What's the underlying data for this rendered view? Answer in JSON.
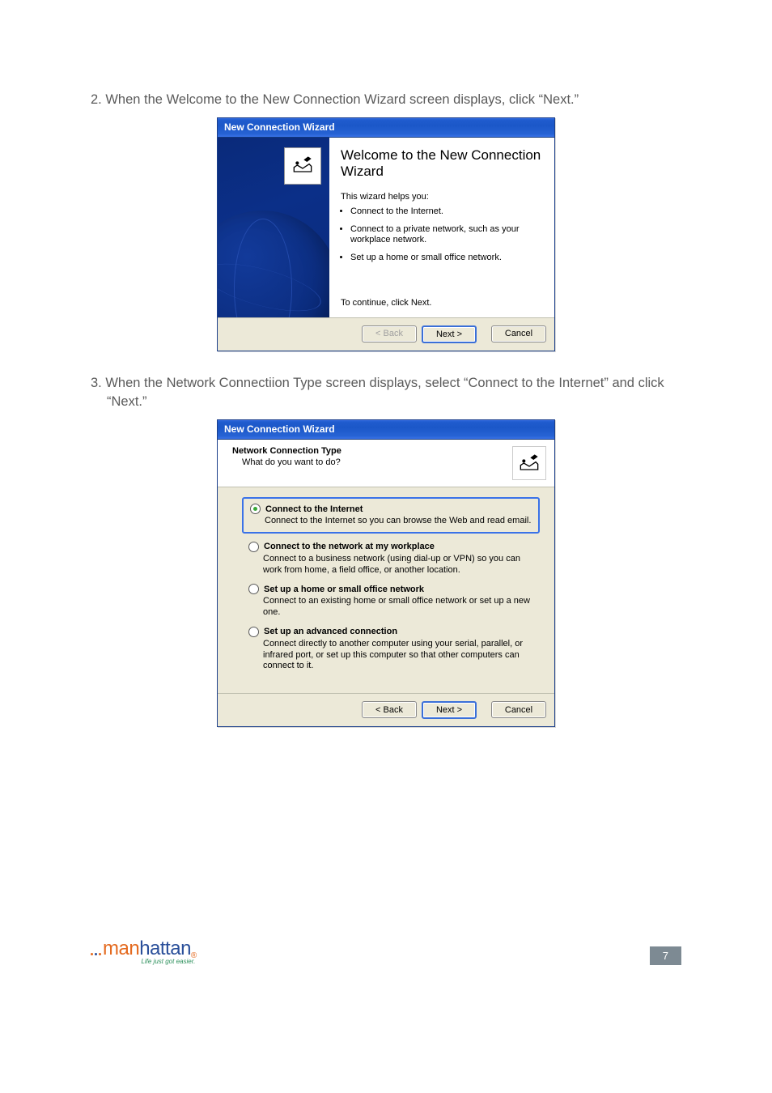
{
  "step2": {
    "num": "2.",
    "text": "When the Welcome to the New Connection Wizard screen displays, click “Next.”"
  },
  "step3": {
    "num": "3.",
    "text": "When the Network Connectiion Type screen displays, select “Connect to the Internet” and click “Next.”"
  },
  "dialog1": {
    "title": "New Connection Wizard",
    "heading": "Welcome to the New Connection Wizard",
    "helps": "This wizard helps you:",
    "bullets": [
      "Connect to the Internet.",
      "Connect to a private network, such as your workplace network.",
      "Set up a home or small office network."
    ],
    "continue": "To continue, click Next.",
    "back": "< Back",
    "next": "Next >",
    "cancel": "Cancel"
  },
  "dialog2": {
    "title": "New Connection Wizard",
    "header_title": "Network Connection Type",
    "header_sub": "What do you want to do?",
    "options": [
      {
        "label": "Connect to the Internet",
        "desc": "Connect to the Internet so you can browse the Web and read email.",
        "checked": true
      },
      {
        "label": "Connect to the network at my workplace",
        "desc": "Connect to a business network (using dial-up or VPN) so you can work from home, a field office, or another location.",
        "checked": false
      },
      {
        "label": "Set up a home or small office network",
        "desc": "Connect to an existing home or small office network or set up a new one.",
        "checked": false
      },
      {
        "label": "Set up an advanced connection",
        "desc": "Connect directly to another computer using your serial, parallel, or infrared port, or set up this computer so that other computers can connect to it.",
        "checked": false
      }
    ],
    "back": "< Back",
    "next": "Next >",
    "cancel": "Cancel"
  },
  "footer": {
    "brand1": "man",
    "brand2": "hattan",
    "tagline": "Life just got easier.",
    "page": "7"
  }
}
